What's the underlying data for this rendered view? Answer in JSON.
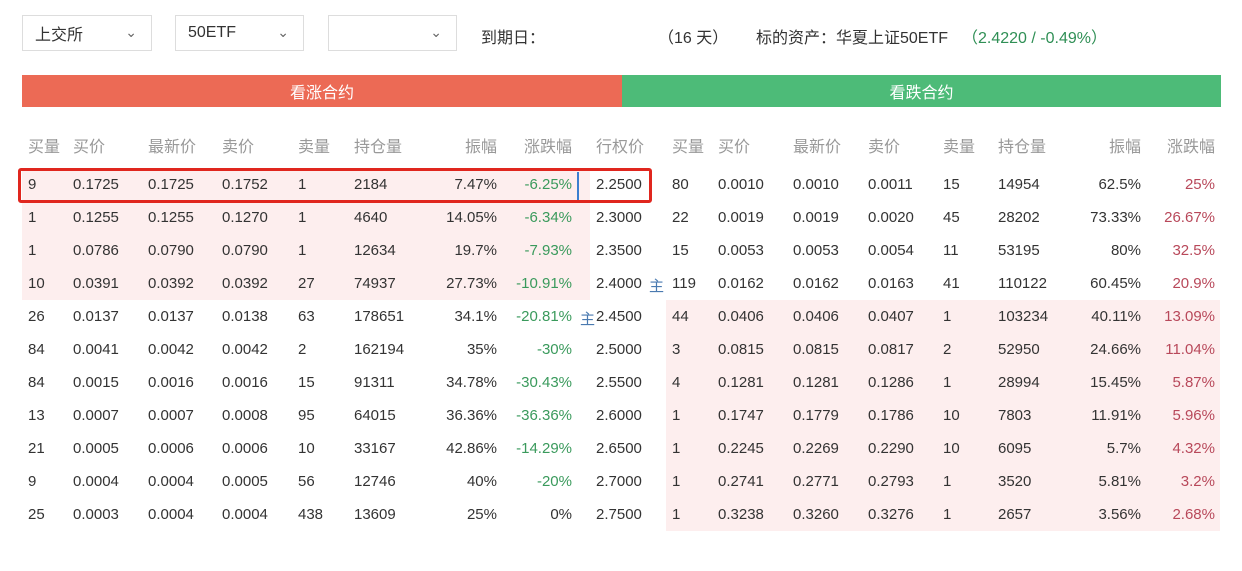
{
  "filters": {
    "exchange": "上交所",
    "underlying": "50ETF",
    "expiry": ""
  },
  "info": {
    "expiry_label": "到期日：",
    "days": "（16 天）",
    "asset_label": "标的资产：华夏上证50ETF",
    "asset_quote": "（2.4220 / -0.49%）"
  },
  "bands": {
    "call": "看涨合约",
    "put": "看跌合约"
  },
  "headers": {
    "call": [
      "买量",
      "买价",
      "最新价",
      "卖价",
      "卖量",
      "持仓量",
      "振幅",
      "涨跌幅"
    ],
    "strike": "行权价",
    "put": [
      "买量",
      "买价",
      "最新价",
      "卖价",
      "卖量",
      "持仓量",
      "振幅",
      "涨跌幅"
    ]
  },
  "rows": [
    {
      "call": [
        "9",
        "0.1725",
        "0.1725",
        "0.1752",
        "1",
        "2184",
        "7.47%",
        "-6.25%"
      ],
      "strike": "2.2500",
      "put": [
        "80",
        "0.0010",
        "0.0010",
        "0.0011",
        "15",
        "14954",
        "62.5%",
        "25%"
      ],
      "call_marker": "",
      "strike_marker": ""
    },
    {
      "call": [
        "1",
        "0.1255",
        "0.1255",
        "0.1270",
        "1",
        "4640",
        "14.05%",
        "-6.34%"
      ],
      "strike": "2.3000",
      "put": [
        "22",
        "0.0019",
        "0.0019",
        "0.0020",
        "45",
        "28202",
        "73.33%",
        "26.67%"
      ],
      "call_marker": "",
      "strike_marker": ""
    },
    {
      "call": [
        "1",
        "0.0786",
        "0.0790",
        "0.0790",
        "1",
        "12634",
        "19.7%",
        "-7.93%"
      ],
      "strike": "2.3500",
      "put": [
        "15",
        "0.0053",
        "0.0053",
        "0.0054",
        "11",
        "53195",
        "80%",
        "32.5%"
      ],
      "call_marker": "",
      "strike_marker": ""
    },
    {
      "call": [
        "10",
        "0.0391",
        "0.0392",
        "0.0392",
        "27",
        "74937",
        "27.73%",
        "-10.91%"
      ],
      "strike": "2.4000",
      "put": [
        "119",
        "0.0162",
        "0.0162",
        "0.0163",
        "41",
        "110122",
        "60.45%",
        "20.9%"
      ],
      "call_marker": "",
      "strike_marker": "主"
    },
    {
      "call": [
        "26",
        "0.0137",
        "0.0137",
        "0.0138",
        "63",
        "178651",
        "34.1%",
        "-20.81%"
      ],
      "strike": "2.4500",
      "put": [
        "44",
        "0.0406",
        "0.0406",
        "0.0407",
        "1",
        "103234",
        "40.11%",
        "13.09%"
      ],
      "call_marker": "主",
      "strike_marker": ""
    },
    {
      "call": [
        "84",
        "0.0041",
        "0.0042",
        "0.0042",
        "2",
        "162194",
        "35%",
        "-30%"
      ],
      "strike": "2.5000",
      "put": [
        "3",
        "0.0815",
        "0.0815",
        "0.0817",
        "2",
        "52950",
        "24.66%",
        "11.04%"
      ],
      "call_marker": "",
      "strike_marker": ""
    },
    {
      "call": [
        "84",
        "0.0015",
        "0.0016",
        "0.0016",
        "15",
        "91311",
        "34.78%",
        "-30.43%"
      ],
      "strike": "2.5500",
      "put": [
        "4",
        "0.1281",
        "0.1281",
        "0.1286",
        "1",
        "28994",
        "15.45%",
        "5.87%"
      ],
      "call_marker": "",
      "strike_marker": ""
    },
    {
      "call": [
        "13",
        "0.0007",
        "0.0007",
        "0.0008",
        "95",
        "64015",
        "36.36%",
        "-36.36%"
      ],
      "strike": "2.6000",
      "put": [
        "1",
        "0.1747",
        "0.1779",
        "0.1786",
        "10",
        "7803",
        "11.91%",
        "5.96%"
      ],
      "call_marker": "",
      "strike_marker": ""
    },
    {
      "call": [
        "21",
        "0.0005",
        "0.0006",
        "0.0006",
        "10",
        "33167",
        "42.86%",
        "-14.29%"
      ],
      "strike": "2.6500",
      "put": [
        "1",
        "0.2245",
        "0.2269",
        "0.2290",
        "10",
        "6095",
        "5.7%",
        "4.32%"
      ],
      "call_marker": "",
      "strike_marker": ""
    },
    {
      "call": [
        "9",
        "0.0004",
        "0.0004",
        "0.0005",
        "56",
        "12746",
        "40%",
        "-20%"
      ],
      "strike": "2.7000",
      "put": [
        "1",
        "0.2741",
        "0.2771",
        "0.2793",
        "1",
        "3520",
        "5.81%",
        "3.2%"
      ],
      "call_marker": "",
      "strike_marker": ""
    },
    {
      "call": [
        "25",
        "0.0003",
        "0.0004",
        "0.0004",
        "438",
        "13609",
        "25%",
        "0%"
      ],
      "strike": "2.7500",
      "put": [
        "1",
        "0.3238",
        "0.3260",
        "0.3276",
        "1",
        "2657",
        "3.56%",
        "2.68%"
      ],
      "call_marker": "",
      "strike_marker": ""
    }
  ],
  "highlight": {
    "call_itm_rows": [
      0,
      1,
      2,
      3
    ],
    "put_itm_rows": [
      4,
      5,
      6,
      7,
      8,
      9,
      10
    ],
    "selected_row": 0
  },
  "colors": {
    "call_band": "#ec6a55",
    "put_band": "#4dbb78",
    "up": "#b8485a",
    "down": "#3a9a5c",
    "itm_bg": "#fdeeee"
  }
}
